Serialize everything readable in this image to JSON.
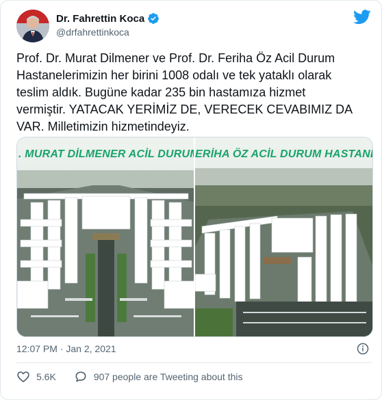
{
  "author": {
    "display_name": "Dr. Fahrettin Koca",
    "handle": "@drfahrettinkoca",
    "avatar_icon": "profile-photo",
    "verified": true
  },
  "tweet": {
    "text": "Prof. Dr. Murat Dilmener ve Prof. Dr. Feriha Öz Acil Durum\nHastanelerimizin her birini 1008 odalı ve tek yataklı olarak\nteslim aldık. Bugüne kadar 235 bin hastamıza hizmet\nvermiştir. YATACAK YERİMİZ DE, VERECEK CEVABIMIZ DA\nVAR. Milletimizin hizmetindeyiz."
  },
  "media": {
    "left_banner": ". MURAT DİLMENER ACİL DURUM HASTA",
    "right_banner": "ERİHA ÖZ ACİL DURUM HASTANESİ"
  },
  "meta": {
    "time": "12:07 PM",
    "separator": " · ",
    "date": "Jan 2, 2021"
  },
  "actions": {
    "likes": "5.6K",
    "tweeting": "907 people are Tweeting about this"
  },
  "colors": {
    "twitter_blue": "#1d9bf0",
    "banner_green": "#19a36b",
    "muted": "#536471"
  }
}
